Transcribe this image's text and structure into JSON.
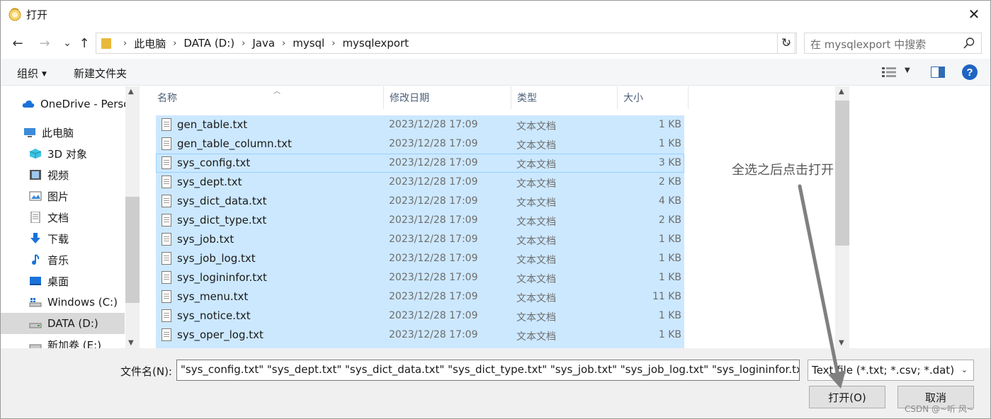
{
  "window": {
    "title": "打开",
    "close": "✕"
  },
  "nav": {
    "back": "←",
    "forward": "→",
    "recent": "⌄",
    "up": "↑",
    "breadcrumb": [
      "此电脑",
      "DATA (D:)",
      "Java",
      "mysql",
      "mysqlexport"
    ],
    "refresh": "↻",
    "search_placeholder": "在 mysqlexport 中搜索"
  },
  "commandbar": {
    "organize": "组织",
    "new_folder": "新建文件夹",
    "help": "?"
  },
  "sidebar": {
    "items": [
      {
        "label": "OneDrive - Perso",
        "icon": "cloud-icon"
      },
      {
        "label": "此电脑",
        "icon": "computer-icon"
      },
      {
        "label": "3D 对象",
        "icon": "cube-icon"
      },
      {
        "label": "视频",
        "icon": "video-icon"
      },
      {
        "label": "图片",
        "icon": "picture-icon"
      },
      {
        "label": "文档",
        "icon": "document-icon"
      },
      {
        "label": "下载",
        "icon": "download-icon"
      },
      {
        "label": "音乐",
        "icon": "music-icon"
      },
      {
        "label": "桌面",
        "icon": "desktop-icon"
      },
      {
        "label": "Windows (C:)",
        "icon": "drive-icon"
      },
      {
        "label": "DATA (D:)",
        "icon": "drive-icon",
        "selected": true
      },
      {
        "label": "新加卷 (E:)",
        "icon": "drive-icon"
      }
    ]
  },
  "columns": {
    "name": "名称",
    "date": "修改日期",
    "type": "类型",
    "size": "大小"
  },
  "files": [
    {
      "name": "gen_table.txt",
      "date": "2023/12/28 17:09",
      "type": "文本文档",
      "size": "1 KB"
    },
    {
      "name": "gen_table_column.txt",
      "date": "2023/12/28 17:09",
      "type": "文本文档",
      "size": "1 KB"
    },
    {
      "name": "sys_config.txt",
      "date": "2023/12/28 17:09",
      "type": "文本文档",
      "size": "3 KB"
    },
    {
      "name": "sys_dept.txt",
      "date": "2023/12/28 17:09",
      "type": "文本文档",
      "size": "2 KB"
    },
    {
      "name": "sys_dict_data.txt",
      "date": "2023/12/28 17:09",
      "type": "文本文档",
      "size": "4 KB"
    },
    {
      "name": "sys_dict_type.txt",
      "date": "2023/12/28 17:09",
      "type": "文本文档",
      "size": "2 KB"
    },
    {
      "name": "sys_job.txt",
      "date": "2023/12/28 17:09",
      "type": "文本文档",
      "size": "1 KB"
    },
    {
      "name": "sys_job_log.txt",
      "date": "2023/12/28 17:09",
      "type": "文本文档",
      "size": "1 KB"
    },
    {
      "name": "sys_logininfor.txt",
      "date": "2023/12/28 17:09",
      "type": "文本文档",
      "size": "1 KB"
    },
    {
      "name": "sys_menu.txt",
      "date": "2023/12/28 17:09",
      "type": "文本文档",
      "size": "11 KB"
    },
    {
      "name": "sys_notice.txt",
      "date": "2023/12/28 17:09",
      "type": "文本文档",
      "size": "1 KB"
    },
    {
      "name": "sys_oper_log.txt",
      "date": "2023/12/28 17:09",
      "type": "文本文档",
      "size": "1 KB"
    }
  ],
  "annotation": "全选之后点击打开",
  "bottom": {
    "filename_label": "文件名(N):",
    "filename_value": "\"sys_config.txt\" \"sys_dept.txt\" \"sys_dict_data.txt\" \"sys_dict_type.txt\" \"sys_job.txt\" \"sys_job_log.txt\" \"sys_logininfor.txt\"",
    "filter": "Text file (*.txt; *.csv; *.dat)",
    "open": "打开(O)",
    "cancel": "取消"
  },
  "watermark": "CSDN @~听 风~",
  "colors": {
    "selection": "#cce8ff",
    "accent": "#1f63c4",
    "annotation_arrow": "#808080"
  }
}
